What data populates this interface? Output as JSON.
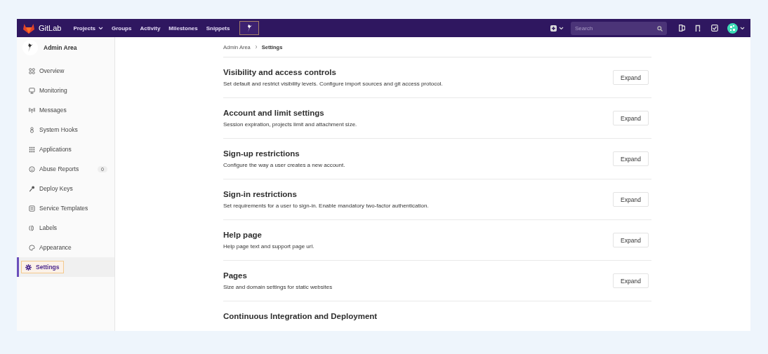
{
  "navbar": {
    "brand": "GitLab",
    "links": [
      {
        "label": "Projects",
        "dropdown": true
      },
      {
        "label": "Groups",
        "dropdown": false
      },
      {
        "label": "Activity",
        "dropdown": false
      },
      {
        "label": "Milestones",
        "dropdown": false
      },
      {
        "label": "Snippets",
        "dropdown": false
      }
    ],
    "admin_selected": true,
    "search": {
      "placeholder": "Search"
    }
  },
  "sidebar": {
    "title": "Admin Area",
    "items": [
      {
        "label": "Overview",
        "selected": false
      },
      {
        "label": "Monitoring",
        "selected": false
      },
      {
        "label": "Messages",
        "selected": false
      },
      {
        "label": "System Hooks",
        "selected": false
      },
      {
        "label": "Applications",
        "selected": false
      },
      {
        "label": "Abuse Reports",
        "selected": false,
        "count": "0"
      },
      {
        "label": "Deploy Keys",
        "selected": false
      },
      {
        "label": "Service Templates",
        "selected": false
      },
      {
        "label": "Labels",
        "selected": false
      },
      {
        "label": "Appearance",
        "selected": false
      },
      {
        "label": "Settings",
        "selected": true
      }
    ]
  },
  "breadcrumb": [
    "Admin Area",
    "Settings"
  ],
  "sections": [
    {
      "title": "Visibility and access controls",
      "description": "Set default and restrict visibility levels. Configure import sources and git access protocol.",
      "button": "Expand"
    },
    {
      "title": "Account and limit settings",
      "description": "Session expiration, projects limit and attachment size.",
      "button": "Expand"
    },
    {
      "title": "Sign-up restrictions",
      "description": "Configure the way a user creates a new account.",
      "button": "Expand"
    },
    {
      "title": "Sign-in restrictions",
      "description": "Set requirements for a user to sign-in. Enable mandatory two-factor authentication.",
      "button": "Expand"
    },
    {
      "title": "Help page",
      "description": "Help page text and support page url.",
      "button": "Expand"
    },
    {
      "title": "Pages",
      "description": "Size and domain settings for static websites",
      "button": "Expand"
    },
    {
      "title": "Continuous Integration and Deployment"
    }
  ]
}
